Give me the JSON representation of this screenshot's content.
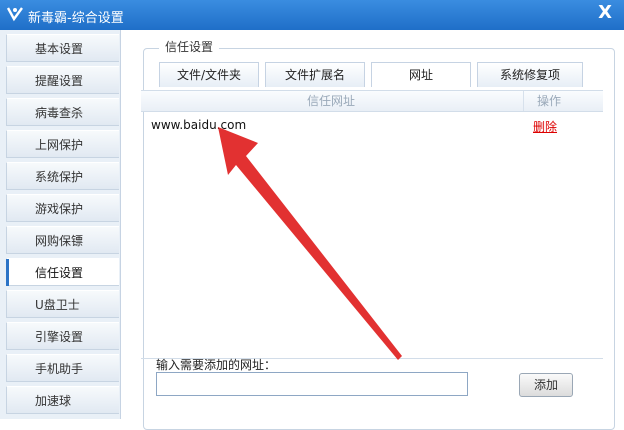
{
  "window": {
    "title": "新毒霸-综合设置",
    "close_label": "X"
  },
  "sidebar": {
    "items": [
      {
        "label": "基本设置"
      },
      {
        "label": "提醒设置"
      },
      {
        "label": "病毒查杀"
      },
      {
        "label": "上网保护"
      },
      {
        "label": "系统保护"
      },
      {
        "label": "游戏保护"
      },
      {
        "label": "网购保镖"
      },
      {
        "label": "信任设置",
        "active": true
      },
      {
        "label": "U盘卫士"
      },
      {
        "label": "引擎设置"
      },
      {
        "label": "手机助手"
      },
      {
        "label": "加速球"
      }
    ]
  },
  "main": {
    "group_title": "信任设置",
    "tabs": [
      {
        "label": "文件/文件夹"
      },
      {
        "label": "文件扩展名"
      },
      {
        "label": "网址",
        "active": true
      },
      {
        "label": "系统修复项"
      }
    ],
    "table": {
      "headers": {
        "url": "信任网址",
        "op": "操作"
      },
      "rows": [
        {
          "url": "www.baidu.com",
          "action": "删除"
        }
      ]
    },
    "input": {
      "label": "输入需要添加的网址：",
      "value": "",
      "placeholder": ""
    },
    "add_button_label": "添加"
  },
  "colors": {
    "titlebar": "#2a7ed4",
    "accent": "#2b73c6",
    "delete": "#dd0000",
    "arrow": "#e02020"
  },
  "icons": {
    "logo": "duba-logo-icon",
    "close": "close-icon"
  }
}
